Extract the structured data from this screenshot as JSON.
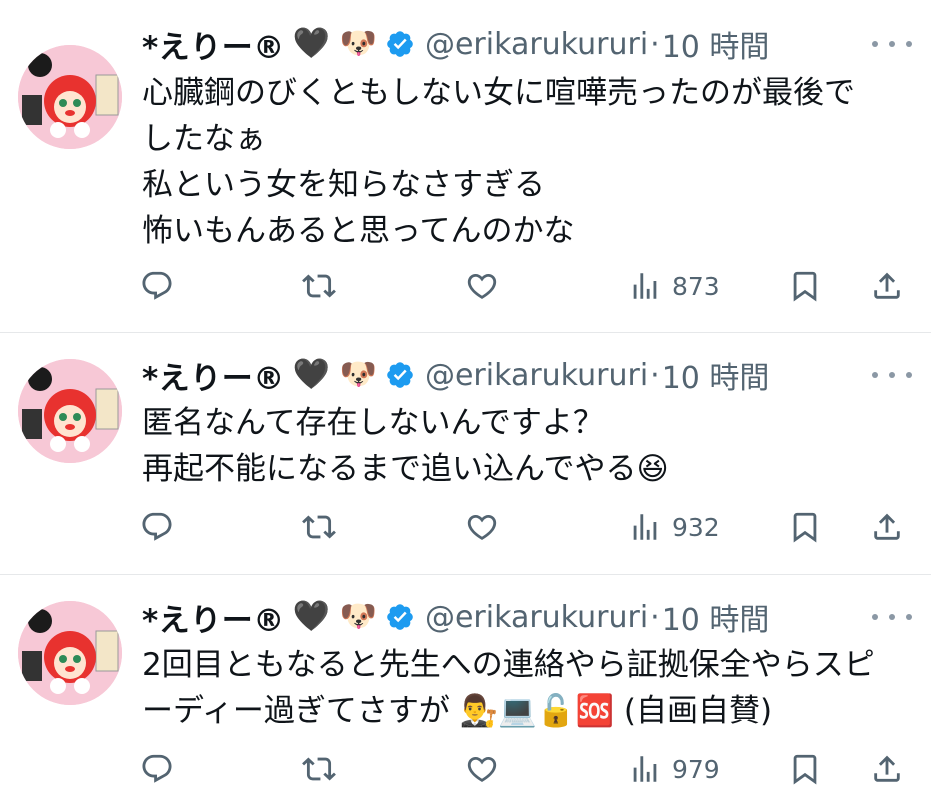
{
  "tweets": [
    {
      "name": "*えりー®",
      "name_emoji": "🖤 🐶",
      "handle": "@erikarukururi",
      "dot": "·",
      "time": "10 時間",
      "lines": [
        "心臓鋼のびくともしない女に喧嘩売ったのが最後で",
        "したなぁ",
        "私という女を知らなさすぎる",
        "怖いもんあると思ってんのかな"
      ],
      "views": "873"
    },
    {
      "name": "*えりー®",
      "name_emoji": "🖤 🐶",
      "handle": "@erikarukururi",
      "dot": "·",
      "time": "10 時間",
      "lines": [
        "匿名なんて存在しないんですよ？",
        "再起不能になるまで追い込んでやる😆"
      ],
      "views": "932"
    },
    {
      "name": "*えりー®",
      "name_emoji": "🖤 🐶",
      "handle": "@erikarukururi",
      "dot": "·",
      "time": "10 時間",
      "lines": [
        "2回目ともなると先生への連絡やら証拠保全やらスピ",
        "ーディー過ぎてさすが 👨‍⚖️💻🔓🆘 (自画自賛)"
      ],
      "views": "979"
    }
  ],
  "icons": {
    "reply": "reply-icon",
    "retweet": "retweet-icon",
    "like": "heart-icon",
    "views": "views-icon",
    "bookmark": "bookmark-icon",
    "share": "share-icon",
    "more": "more-icon",
    "verified": "verified-badge-icon"
  },
  "colors": {
    "text": "#0f1419",
    "secondary": "#536471",
    "verified": "#1d9bf0",
    "divider": "#e6e8ea",
    "avatar_bg": "#f7c8d6"
  }
}
